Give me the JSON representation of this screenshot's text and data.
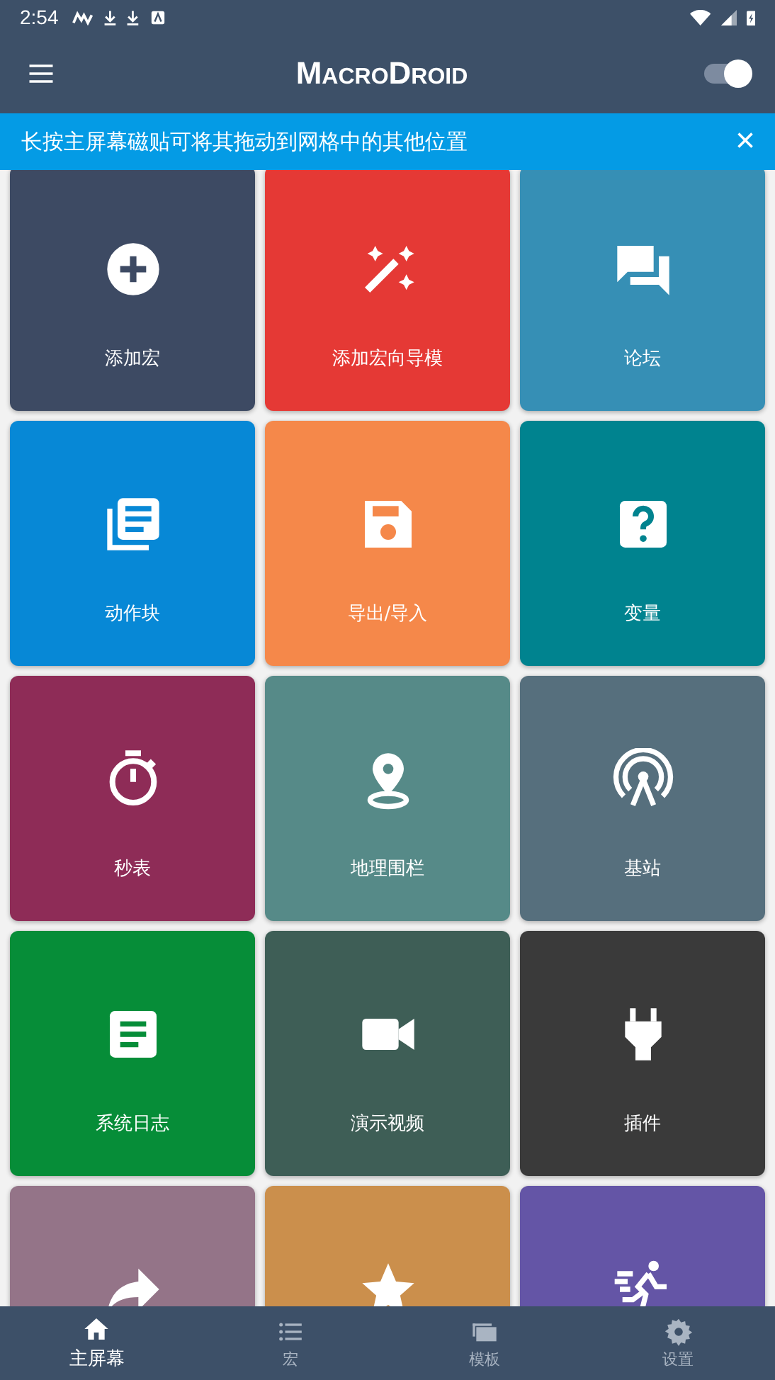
{
  "status_bar": {
    "time": "2:54"
  },
  "app_bar": {
    "title_parts": [
      {
        "big": "M",
        "small": "ACRO"
      },
      {
        "big": "D",
        "small": "ROID"
      }
    ],
    "switch": {
      "on": true
    }
  },
  "banner": {
    "text": "长按主屏幕磁贴可将其拖动到网格中的其他位置",
    "close": "×"
  },
  "tiles": [
    {
      "label": "添加宏",
      "color": "#3d4a63"
    },
    {
      "label": "添加宏向导模",
      "color": "#e53935"
    },
    {
      "label": "论坛",
      "color": "#368fb5"
    },
    {
      "label": "动作块",
      "color": "#0788d6"
    },
    {
      "label": "导出/导入",
      "color": "#f5884a"
    },
    {
      "label": "变量",
      "color": "#00838f"
    },
    {
      "label": "秒表",
      "color": "#8e2c57"
    },
    {
      "label": "地理围栏",
      "color": "#568a88"
    },
    {
      "label": "基站",
      "color": "#566f7d"
    },
    {
      "label": "系统日志",
      "color": "#068d38"
    },
    {
      "label": "演示视频",
      "color": "#3e5e56"
    },
    {
      "label": "插件",
      "color": "#3a3a3a"
    },
    {
      "color": "#947488"
    },
    {
      "color": "#cb8f4c"
    },
    {
      "color": "#6455a6"
    }
  ],
  "bottom_nav": [
    {
      "label": "主屏幕",
      "selected": true
    },
    {
      "label": "宏",
      "selected": false
    },
    {
      "label": "模板",
      "selected": false
    },
    {
      "label": "设置",
      "selected": false
    }
  ]
}
